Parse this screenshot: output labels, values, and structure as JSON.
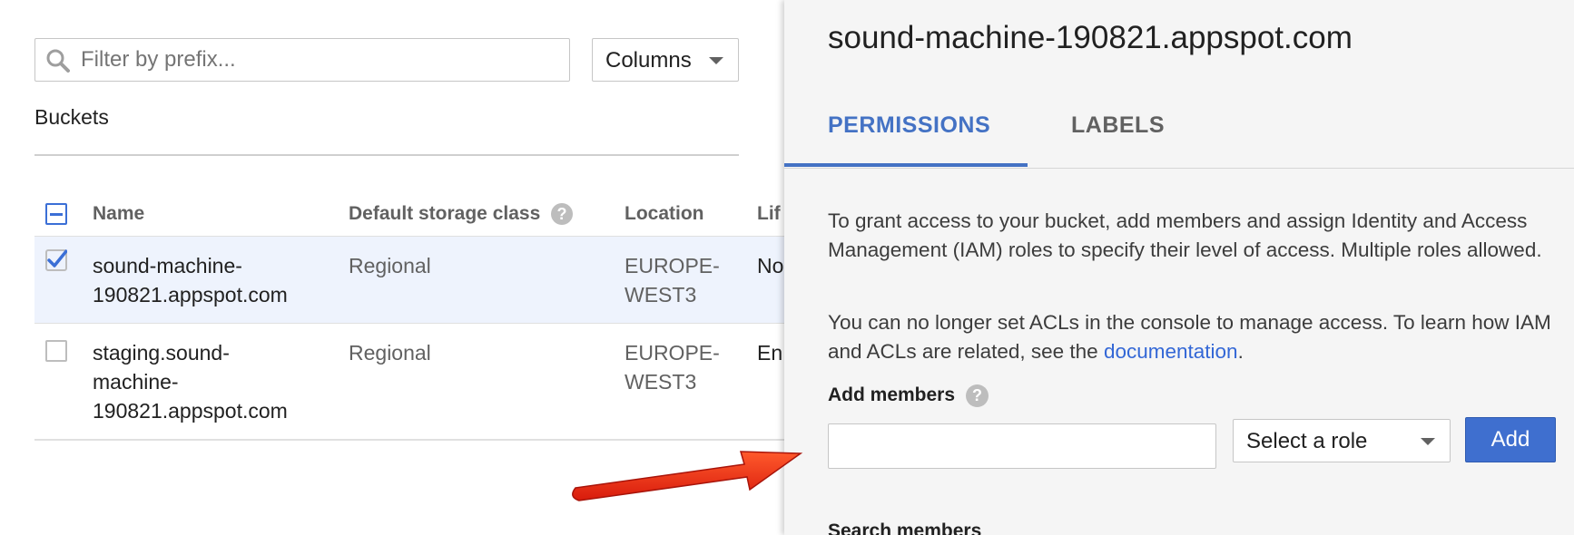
{
  "filter": {
    "placeholder": "Filter by prefix..."
  },
  "columns_button": {
    "label": "Columns"
  },
  "buckets_title": "Buckets",
  "table": {
    "headers": {
      "name": "Name",
      "storage_class": "Default storage class",
      "location": "Location",
      "lifecycle": "Lif"
    },
    "rows": [
      {
        "name": "sound-machine-190821.appspot.com",
        "storage_class": "Regional",
        "location": "EUROPE-WEST3",
        "lifecycle": "No",
        "checked": true
      },
      {
        "name": "staging.sound-machine-190821.appspot.com",
        "storage_class": "Regional",
        "location": "EUROPE-WEST3",
        "lifecycle": "En",
        "checked": false
      }
    ]
  },
  "panel": {
    "title": "sound-machine-190821.appspot.com",
    "tabs": [
      {
        "label": "PERMISSIONS",
        "active": true
      },
      {
        "label": "LABELS",
        "active": false
      }
    ],
    "paragraph1": "To grant access to your bucket, add members and assign Identity and Access Management (IAM) roles to specify their level of access. Multiple roles allowed.",
    "paragraph2_text": "You can no longer set ACLs in the console to manage access. To learn how IAM and ACLs are related, see the ",
    "paragraph2_link": "documentation",
    "paragraph2_end": ".",
    "add_members_label": "Add members",
    "member_input_value": "",
    "role_select": "Select a role",
    "add_button": "Add",
    "search_members_label": "Search members"
  },
  "colors": {
    "accent": "#4472c4",
    "button": "#3f6fcf",
    "selected_row": "#eef3fd",
    "panel_bg": "#f5f5f5",
    "arrow": "#e8301c"
  }
}
